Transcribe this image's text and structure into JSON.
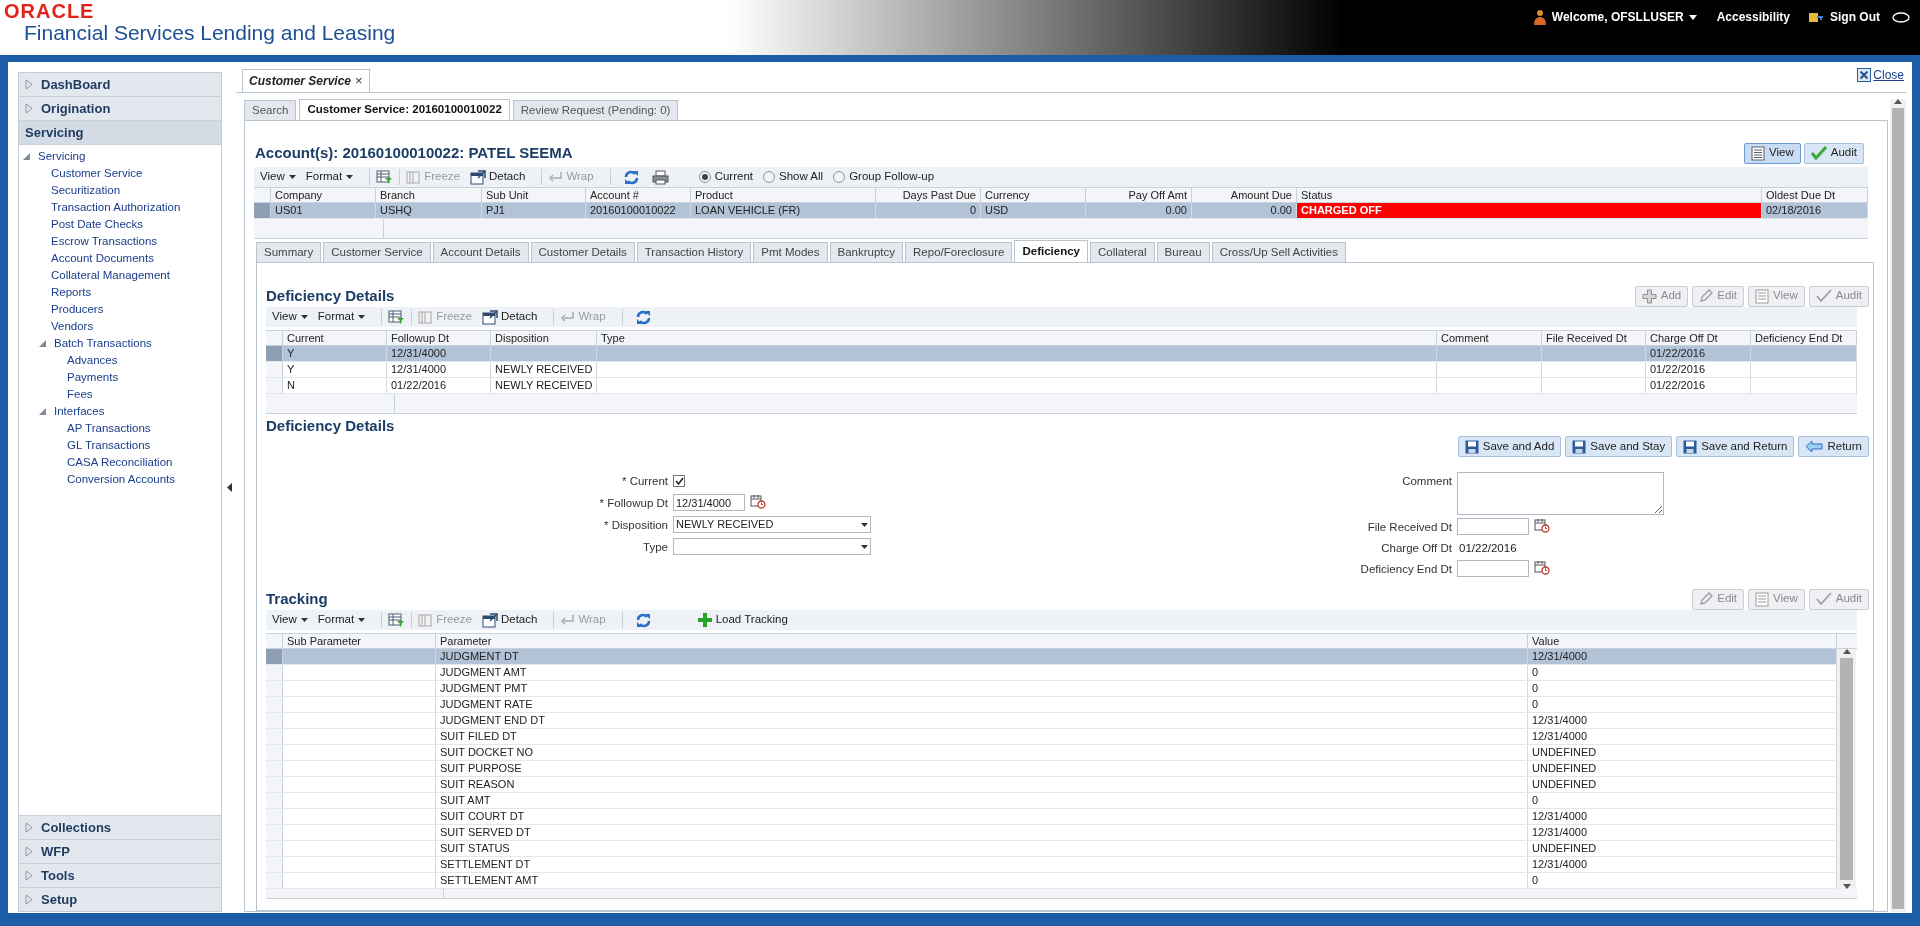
{
  "header": {
    "brand": "ORACLE",
    "product": "Financial Services Lending and Leasing",
    "welcome": "Welcome, OFSLLUSER",
    "accessibility": "Accessibility",
    "sign_out": "Sign Out"
  },
  "sidebar": {
    "top_sections": [
      {
        "label": "DashBoard",
        "expanded": false
      },
      {
        "label": "Origination",
        "expanded": false
      },
      {
        "label": "Servicing",
        "expanded": true
      }
    ],
    "tree": [
      {
        "label": "Servicing",
        "expanded": true,
        "children": [
          {
            "label": "Customer Service"
          },
          {
            "label": "Securitization"
          },
          {
            "label": "Transaction Authorization"
          },
          {
            "label": "Post Date Checks"
          },
          {
            "label": "Escrow Transactions"
          },
          {
            "label": "Account Documents"
          },
          {
            "label": "Collateral Management"
          },
          {
            "label": "Reports"
          },
          {
            "label": "Producers"
          },
          {
            "label": "Vendors"
          },
          {
            "label": "Batch Transactions",
            "expanded": true,
            "children": [
              {
                "label": "Advances"
              },
              {
                "label": "Payments"
              },
              {
                "label": "Fees"
              }
            ]
          },
          {
            "label": "Interfaces",
            "expanded": true,
            "children": [
              {
                "label": "AP Transactions"
              },
              {
                "label": "GL Transactions"
              },
              {
                "label": "CASA Reconciliation"
              },
              {
                "label": "Conversion Accounts"
              }
            ]
          }
        ]
      }
    ],
    "bottom_sections": [
      {
        "label": "Collections",
        "expanded": false
      },
      {
        "label": "WFP",
        "expanded": false
      },
      {
        "label": "Tools",
        "expanded": false
      },
      {
        "label": "Setup",
        "expanded": false
      }
    ]
  },
  "document_tab": {
    "label": "Customer Service",
    "close": "×"
  },
  "close_link": "Close",
  "sub_tabs": [
    {
      "label": "Search",
      "selected": false
    },
    {
      "label": "Customer Service: 20160100010022",
      "selected": true
    },
    {
      "label": "Review Request (Pending: 0)",
      "selected": false
    }
  ],
  "account": {
    "title": "Account(s): 20160100010022: PATEL SEEMA",
    "buttons": [
      {
        "label": "View",
        "kind": "view",
        "pressed": true
      },
      {
        "label": "Audit",
        "kind": "audit",
        "pressed": false
      }
    ],
    "toolbar": [
      {
        "label": "View",
        "kind": "menu",
        "disabled": false
      },
      {
        "label": "Format",
        "kind": "menu",
        "disabled": false
      },
      {
        "label": "Freeze",
        "kind": "freeze",
        "disabled": true
      },
      {
        "label": "Detach",
        "kind": "detach",
        "disabled": false
      },
      {
        "label": "Wrap",
        "kind": "wrap",
        "disabled": true
      }
    ],
    "filters": [
      {
        "label": "Current",
        "selected": true
      },
      {
        "label": "Show All",
        "selected": false
      },
      {
        "label": "Group Follow-up",
        "selected": false
      }
    ],
    "columns": [
      {
        "label": "Company"
      },
      {
        "label": "Branch"
      },
      {
        "label": "Sub Unit"
      },
      {
        "label": "Account #"
      },
      {
        "label": "Product"
      },
      {
        "label": "Days Past Due"
      },
      {
        "label": "Currency"
      },
      {
        "label": "Pay Off Amt"
      },
      {
        "label": "Amount Due"
      },
      {
        "label": "Status"
      },
      {
        "label": "Oldest Due Dt"
      }
    ],
    "rows": [
      {
        "company": "US01",
        "branch": "USHQ",
        "sub_unit": "PJ1",
        "account": "20160100010022",
        "product": "LOAN VEHICLE (FR)",
        "days_past_due": "0",
        "currency": "USD",
        "pay_off_amt": "0.00",
        "amount_due": "0.00",
        "status": "CHARGED OFF",
        "oldest_due_dt": "02/18/2016",
        "selected": true,
        "status_alert": true
      }
    ]
  },
  "detail_tabs": [
    {
      "label": "Summary",
      "selected": false
    },
    {
      "label": "Customer Service",
      "selected": false
    },
    {
      "label": "Account Details",
      "selected": false
    },
    {
      "label": "Customer Details",
      "selected": false
    },
    {
      "label": "Transaction History",
      "selected": false
    },
    {
      "label": "Pmt Modes",
      "selected": false
    },
    {
      "label": "Bankruptcy",
      "selected": false
    },
    {
      "label": "Repo/Foreclosure",
      "selected": false
    },
    {
      "label": "Deficiency",
      "selected": true
    },
    {
      "label": "Collateral",
      "selected": false
    },
    {
      "label": "Bureau",
      "selected": false
    },
    {
      "label": "Cross/Up Sell Activities",
      "selected": false
    }
  ],
  "deficiency": {
    "title": "Deficiency Details",
    "buttons": [
      {
        "label": "Add",
        "kind": "add",
        "disabled": true
      },
      {
        "label": "Edit",
        "kind": "edit",
        "disabled": true
      },
      {
        "label": "View",
        "kind": "view",
        "disabled": true
      },
      {
        "label": "Audit",
        "kind": "audit",
        "disabled": true
      }
    ],
    "toolbar": [
      {
        "label": "View",
        "kind": "menu",
        "disabled": false
      },
      {
        "label": "Format",
        "kind": "menu",
        "disabled": false
      },
      {
        "label": "Freeze",
        "kind": "freeze",
        "disabled": true
      },
      {
        "label": "Detach",
        "kind": "detach",
        "disabled": false
      },
      {
        "label": "Wrap",
        "kind": "wrap",
        "disabled": true
      }
    ],
    "columns": [
      {
        "label": "Current"
      },
      {
        "label": "Followup Dt"
      },
      {
        "label": "Disposition"
      },
      {
        "label": "Type"
      },
      {
        "label": "Comment"
      },
      {
        "label": "File Received Dt"
      },
      {
        "label": "Charge Off Dt"
      },
      {
        "label": "Deficiency End Dt"
      }
    ],
    "rows": [
      {
        "current": "Y",
        "followup_dt": "12/31/4000",
        "charge_off_dt": "01/22/2016",
        "selected": true
      },
      {
        "current": "Y",
        "followup_dt": "12/31/4000",
        "disposition": "NEWLY RECEIVED",
        "charge_off_dt": "01/22/2016",
        "selected": false
      },
      {
        "current": "N",
        "followup_dt": "01/22/2016",
        "disposition": "NEWLY RECEIVED",
        "charge_off_dt": "01/22/2016",
        "selected": false
      }
    ]
  },
  "form": {
    "title": "Deficiency Details",
    "buttons": [
      {
        "label": "Save and Add",
        "kind": "save"
      },
      {
        "label": "Save and Stay",
        "kind": "save"
      },
      {
        "label": "Save and Return",
        "kind": "save"
      },
      {
        "label": "Return",
        "kind": "return"
      }
    ],
    "left_fields": [
      {
        "label": "* Current",
        "kind": "checkbox",
        "checked": true
      },
      {
        "label": "* Followup Dt",
        "kind": "date",
        "value": "12/31/4000"
      },
      {
        "label": "* Disposition",
        "kind": "select",
        "value": "NEWLY RECEIVED"
      },
      {
        "label": "Type",
        "kind": "select"
      }
    ],
    "right_fields": [
      {
        "label": "Comment",
        "kind": "textarea"
      },
      {
        "label": "File Received Dt",
        "kind": "date"
      },
      {
        "label": "Charge Off Dt",
        "kind": "text",
        "value": "01/22/2016"
      },
      {
        "label": "Deficiency End Dt",
        "kind": "date"
      }
    ]
  },
  "tracking": {
    "title": "Tracking",
    "buttons": [
      {
        "label": "Edit",
        "kind": "edit",
        "disabled": true
      },
      {
        "label": "View",
        "kind": "view",
        "disabled": true
      },
      {
        "label": "Audit",
        "kind": "audit",
        "disabled": true
      }
    ],
    "toolbar": [
      {
        "label": "View",
        "kind": "menu",
        "disabled": false
      },
      {
        "label": "Format",
        "kind": "menu",
        "disabled": false
      },
      {
        "label": "Freeze",
        "kind": "freeze",
        "disabled": true
      },
      {
        "label": "Detach",
        "kind": "detach",
        "disabled": false
      },
      {
        "label": "Wrap",
        "kind": "wrap",
        "disabled": true
      }
    ],
    "load_tracking": "Load Tracking",
    "columns": [
      {
        "label": "Sub Parameter"
      },
      {
        "label": "Parameter"
      },
      {
        "label": "Value"
      }
    ],
    "rows": [
      {
        "parameter": "JUDGMENT DT",
        "value": "12/31/4000",
        "selected": true
      },
      {
        "parameter": "JUDGMENT AMT",
        "value": "0",
        "selected": false
      },
      {
        "parameter": "JUDGMENT PMT",
        "value": "0",
        "selected": false
      },
      {
        "parameter": "JUDGMENT RATE",
        "value": "0",
        "selected": false
      },
      {
        "parameter": "JUDGMENT END DT",
        "value": "12/31/4000",
        "selected": false
      },
      {
        "parameter": "SUIT FILED DT",
        "value": "12/31/4000",
        "selected": false
      },
      {
        "parameter": "SUIT DOCKET NO",
        "value": "UNDEFINED",
        "selected": false
      },
      {
        "parameter": "SUIT PURPOSE",
        "value": "UNDEFINED",
        "selected": false
      },
      {
        "parameter": "SUIT REASON",
        "value": "UNDEFINED",
        "selected": false
      },
      {
        "parameter": "SUIT AMT",
        "value": "0",
        "selected": false
      },
      {
        "parameter": "SUIT COURT DT",
        "value": "12/31/4000",
        "selected": false
      },
      {
        "parameter": "SUIT SERVED DT",
        "value": "12/31/4000",
        "selected": false
      },
      {
        "parameter": "SUIT STATUS",
        "value": "UNDEFINED",
        "selected": false
      },
      {
        "parameter": "SETTLEMENT DT",
        "value": "12/31/4000",
        "selected": false
      },
      {
        "parameter": "SETTLEMENT AMT",
        "value": "0",
        "selected": false
      }
    ]
  }
}
